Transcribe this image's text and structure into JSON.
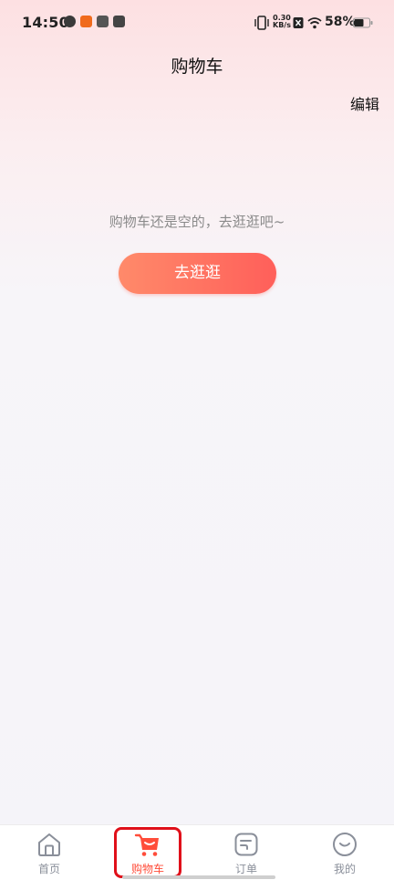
{
  "status_bar": {
    "time": "14:50",
    "net_speed_value": "0.30",
    "net_speed_unit": "KB/s",
    "battery_percent": "58%"
  },
  "header": {
    "title": "购物车",
    "edit_label": "编辑"
  },
  "empty_state": {
    "message": "购物车还是空的，去逛逛吧~",
    "button_label": "去逛逛"
  },
  "tab_bar": {
    "active": "cart",
    "accent_color": "#ff4d3a",
    "items": [
      {
        "id": "home",
        "label": "首页",
        "icon": "home-icon"
      },
      {
        "id": "cart",
        "label": "购物车",
        "icon": "cart-icon"
      },
      {
        "id": "orders",
        "label": "订单",
        "icon": "order-icon"
      },
      {
        "id": "me",
        "label": "我的",
        "icon": "smile-icon"
      }
    ]
  }
}
